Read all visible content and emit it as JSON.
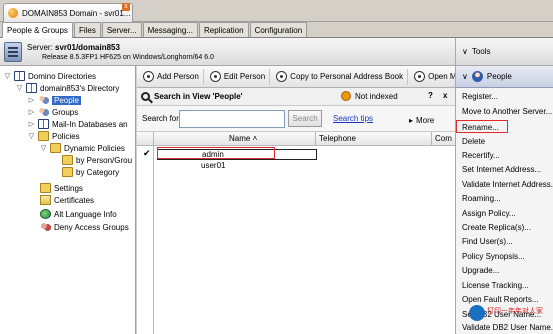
{
  "window": {
    "title": "DOMAIN853 Domain - svr01...",
    "close": "x"
  },
  "tabs": [
    "People & Groups",
    "Files",
    "Server...",
    "Messaging...",
    "Replication",
    "Configuration"
  ],
  "server": {
    "label": "Server:",
    "name": "svr01/domain853",
    "release": "Release 8.5.3FP1 HF625 on Windows/Longhorn/64 6.0"
  },
  "tools_panel": {
    "header": "Tools",
    "section": "People"
  },
  "tree": {
    "items": [
      {
        "label": "Domino Directories",
        "icon": "book-icon",
        "twisty": "▽"
      },
      {
        "label": "domain853's Directory",
        "icon": "book-icon",
        "twisty": "▽"
      },
      {
        "label": "People",
        "icon": "people-icon",
        "twisty": "▷",
        "selected": true
      },
      {
        "label": "Groups",
        "icon": "people-icon",
        "twisty": "▷"
      },
      {
        "label": "Mail-In Databases an",
        "icon": "book-icon",
        "twisty": "▷"
      },
      {
        "label": "Policies",
        "icon": "folder-icon",
        "twisty": "▽"
      },
      {
        "label": "Dynamic Policies",
        "icon": "folder-icon",
        "twisty": "▽"
      },
      {
        "label": "by Person/Grou",
        "icon": "folder-icon",
        "twisty": ""
      },
      {
        "label": "by Category",
        "icon": "folder-icon",
        "twisty": ""
      },
      {
        "label": "Settings",
        "icon": "folder-icon",
        "twisty": ""
      },
      {
        "label": "Certificates",
        "icon": "certificate-icon",
        "twisty": ""
      },
      {
        "label": "Alt Language Info",
        "icon": "globe-icon",
        "twisty": ""
      },
      {
        "label": "Deny Access Groups",
        "icon": "deny-icon",
        "twisty": ""
      }
    ]
  },
  "actions": [
    "Add Person",
    "Edit Person",
    "Copy to Personal Address Book",
    "Open M"
  ],
  "search": {
    "header": "Search in View 'People'",
    "status": "Not indexed",
    "help": "?",
    "close": "x",
    "label": "Search for",
    "value": "",
    "button": "Search",
    "tips": "Search tips",
    "more": "More",
    "more_arrow": "▸"
  },
  "columns": [
    "Name",
    "Telephone",
    "Com"
  ],
  "sort_arrow": "˄",
  "rows": [
    {
      "name": "admin",
      "selected": true,
      "check": "✔"
    },
    {
      "name": "user01",
      "selected": false,
      "check": ""
    }
  ],
  "tools_menu": [
    "Register...",
    "Move to Another Server...",
    "Rename...",
    "Delete",
    "Recertify...",
    "Set Internet Address...",
    "Validate Internet Address...",
    "Roaming...",
    "Assign Policy...",
    "Create Replica(s)...",
    "Find User(s)...",
    "Policy Synopsis...",
    "Upgrade...",
    "License Tracking...",
    "Open Fault Reports...",
    "Set DB2 User Name...",
    "Validate DB2 User Name..."
  ],
  "watermark": "打印一年年对人家",
  "colors": {
    "highlight": "#e3282a",
    "selection": "#3169c6",
    "link": "#1a37c4"
  }
}
